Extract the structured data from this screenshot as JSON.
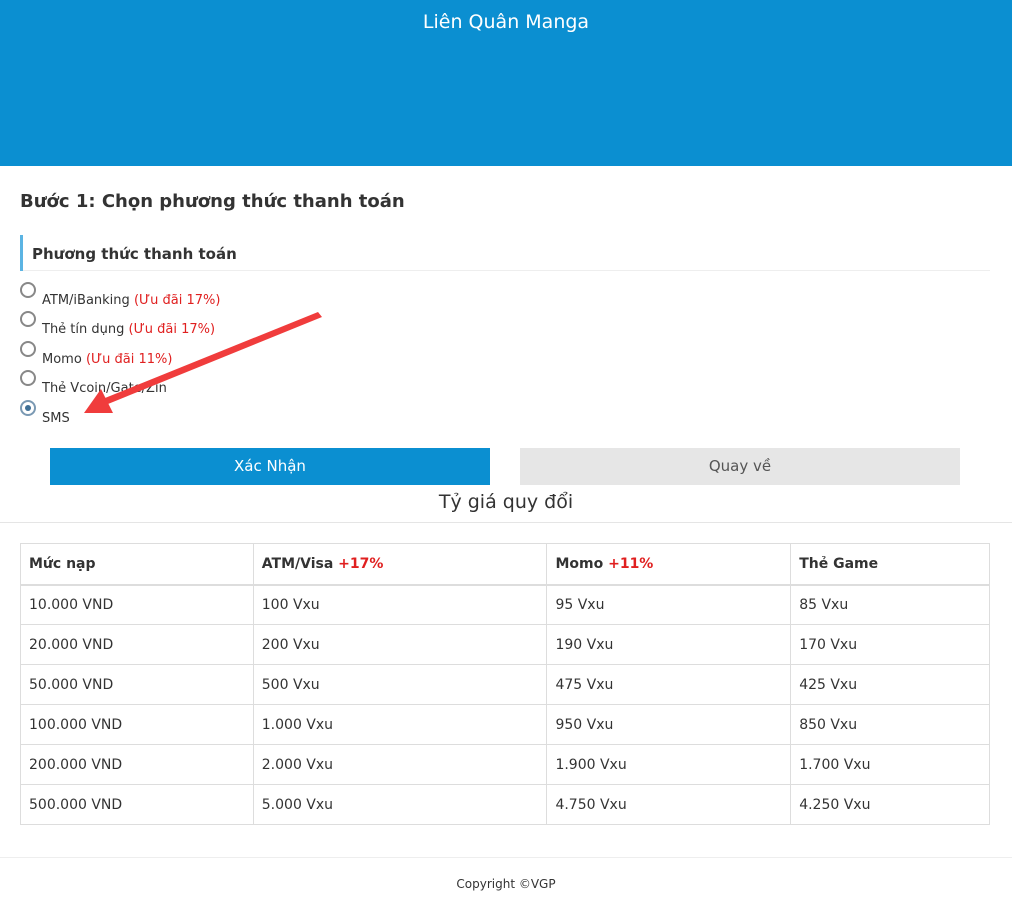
{
  "header": {
    "title": "Liên Quân Manga",
    "background_color": "#0b8fd1"
  },
  "step": {
    "title": "Bước 1: Chọn phương thức thanh toán"
  },
  "payment": {
    "heading": "Phương thức thanh toán",
    "selected": "SMS",
    "options": [
      {
        "label": "ATM/iBanking",
        "offer": "(Ưu đãi 17%)",
        "checked": false
      },
      {
        "label": "Thẻ tín dụng",
        "offer": "(Ưu đãi 17%)",
        "checked": false
      },
      {
        "label": "Momo",
        "offer": "(Ưu đãi 11%)",
        "checked": false
      },
      {
        "label": "Thẻ Vcoin/Gate/Zin",
        "offer": "",
        "checked": false
      },
      {
        "label": "SMS",
        "offer": "",
        "checked": true
      }
    ]
  },
  "annotation": {
    "arrow_color": "#f03c3c",
    "arrow_icon": "red-arrow-annotation"
  },
  "buttons": {
    "confirm_label": "Xác Nhận",
    "back_label": "Quay về"
  },
  "rates": {
    "title": "Tỷ giá quy đổi",
    "headers": [
      {
        "name": "Mức nạp",
        "bonus": ""
      },
      {
        "name": "ATM/Visa",
        "bonus": "+17%"
      },
      {
        "name": "Momo",
        "bonus": "+11%"
      },
      {
        "name": "Thẻ Game",
        "bonus": ""
      }
    ],
    "rows": [
      [
        "10.000 VND",
        "100 Vxu",
        "95 Vxu",
        "85 Vxu"
      ],
      [
        "20.000 VND",
        "200 Vxu",
        "190 Vxu",
        "170 Vxu"
      ],
      [
        "50.000 VND",
        "500 Vxu",
        "475 Vxu",
        "425 Vxu"
      ],
      [
        "100.000 VND",
        "1.000 Vxu",
        "950 Vxu",
        "850 Vxu"
      ],
      [
        "200.000 VND",
        "2.000 Vxu",
        "1.900 Vxu",
        "1.700 Vxu"
      ],
      [
        "500.000 VND",
        "5.000 Vxu",
        "4.750 Vxu",
        "4.250 Vxu"
      ]
    ]
  },
  "footer": {
    "copyright": "Copyright ©VGP"
  }
}
